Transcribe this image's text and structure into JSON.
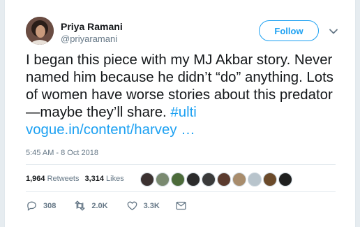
{
  "user": {
    "name": "Priya Ramani",
    "handle": "@priyaramani"
  },
  "follow_label": "Follow",
  "tweet": {
    "text": "I began this piece with my MJ Akbar story. Never named him because he didn’t “do” anything. Lots of women have worse stories about this predator—maybe they’ll share.",
    "hashtag": "#ulti",
    "link": "vogue.in/content/harvey",
    "ellipsis": "…"
  },
  "timestamp": "5:45 AM - 8 Oct 2018",
  "stats": {
    "retweets_count": "1,964",
    "retweets_label": "Retweets",
    "likes_count": "3,314",
    "likes_label": "Likes"
  },
  "face_colors": [
    "#3b3130",
    "#7a8a70",
    "#4c6b3a",
    "#2b2b2b",
    "#3a3a3a",
    "#5b3b2e",
    "#a88c6c",
    "#b8c4cc",
    "#6b4a2a",
    "#1f1f1f"
  ],
  "actions": {
    "replies": "308",
    "retweets": "2.0K",
    "likes": "3.3K"
  },
  "colors": {
    "accent": "#1da1f2",
    "text": "#14171a",
    "muted": "#657786"
  }
}
